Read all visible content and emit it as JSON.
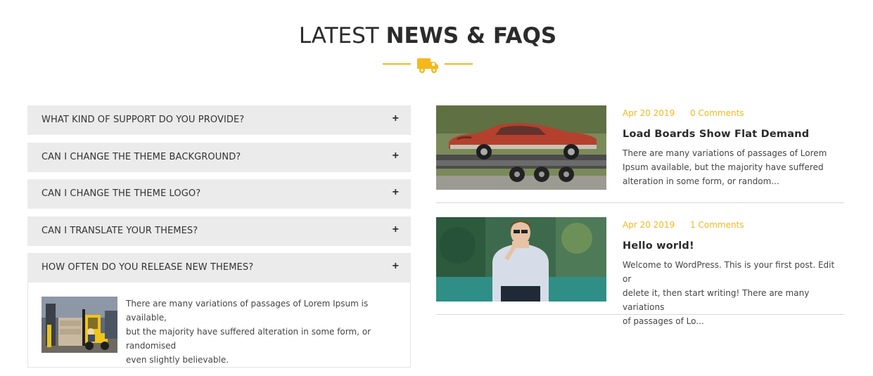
{
  "section": {
    "title_light": "LATEST ",
    "title_bold": "NEWS & FAQS",
    "divider_icon": "truck-icon",
    "accent_color": "#f5b81b"
  },
  "faq": {
    "items": [
      {
        "question": "WHAT KIND OF SUPPORT DO YOU PROVIDE?",
        "toggle": "+"
      },
      {
        "question": "CAN I CHANGE THE THEME BACKGROUND?",
        "toggle": "+"
      },
      {
        "question": "CAN I CHANGE THE THEME LOGO?",
        "toggle": "+"
      },
      {
        "question": "CAN I TRANSLATE YOUR THEMES?",
        "toggle": "+"
      },
      {
        "question": "HOW OFTEN DO YOU RELEASE NEW THEMES?",
        "toggle": "+"
      }
    ],
    "open_answer": {
      "line1": "There are many variations of passages of Lorem Ipsum is available,",
      "line2": "but the majority have suffered alteration in some form, or randomised",
      "line3": "even slightly believable."
    }
  },
  "news": [
    {
      "date": "Apr 20 2019",
      "comments": "0 Comments",
      "title": "Load Boards Show Flat Demand",
      "excerpt_lines": [
        "There are many variations of passages of Lorem",
        "Ipsum available, but the majority have suffered",
        "alteration in some form, or random..."
      ]
    },
    {
      "date": "Apr 20 2019",
      "comments": "1 Comments",
      "title": "Hello world!",
      "excerpt_lines": [
        "Welcome to WordPress. This is your first post. Edit or",
        "delete it, then start writing! There are many variations",
        "of passages of Lo..."
      ]
    }
  ]
}
